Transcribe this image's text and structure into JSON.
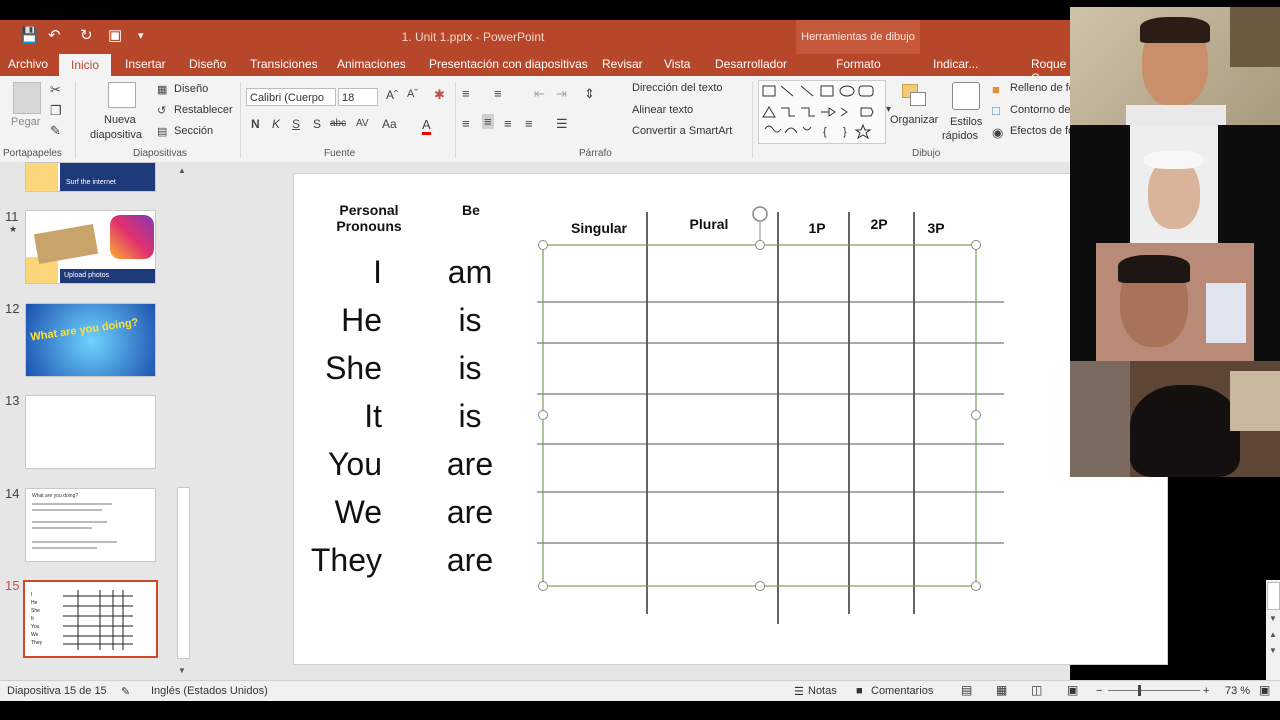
{
  "app": {
    "doc_title": "1. Unit 1.pptx  -  PowerPoint",
    "context_title": "Herramientas de dibujo"
  },
  "tabs": [
    "Archivo",
    "Inicio",
    "Insertar",
    "Diseño",
    "Transiciones",
    "Animaciones",
    "Presentación con diapositivas",
    "Revisar",
    "Vista",
    "Desarrollador",
    "Formato",
    "Indicar...",
    "Roque C"
  ],
  "ribbon": {
    "paste": "Pegar",
    "new_slide": "Nueva",
    "new_slide2": "diapositiva",
    "layout": "Diseño",
    "reset": "Restablecer",
    "section": "Sección",
    "font_name": "Calibri (Cuerpo",
    "font_size": "18",
    "text_direction": "Dirección del texto",
    "align_text": "Alinear texto",
    "convert_smartart": "Convertir a SmartArt",
    "organize": "Organizar",
    "quick_styles": "Estilos",
    "quick_styles2": "rápidos",
    "fill": "Relleno de fo",
    "outline": "Contorno de",
    "effects": "Efectos de fo",
    "groups": [
      "Portapapeles",
      "Diapositivas",
      "Fuente",
      "Párrafo",
      "Dibujo"
    ]
  },
  "thumbnails": [
    {
      "num": "11",
      "caption": "Upload photos"
    },
    {
      "num": "12",
      "caption": "What are you doing?"
    },
    {
      "num": "13",
      "caption": ""
    },
    {
      "num": "14",
      "caption": "What are you doing?"
    },
    {
      "num": "15",
      "caption": ""
    }
  ],
  "thumb_top_caption": "Surf the internet",
  "slide": {
    "header_pronouns": "Personal Pronouns",
    "header_be": "Be",
    "pronouns": [
      "I",
      "He",
      "She",
      "It",
      "You",
      "We",
      "They"
    ],
    "verbs": [
      "am",
      "is",
      "is",
      "is",
      "are",
      "are",
      "are"
    ],
    "table_headers": [
      "Singular",
      "Plural",
      "1P",
      "2P",
      "3P"
    ]
  },
  "status": {
    "slide_of": "Diapositiva 15 de 15",
    "language": "Inglés (Estados Unidos)",
    "notes": "Notas",
    "comments": "Comentarios",
    "zoom": "73 %"
  }
}
